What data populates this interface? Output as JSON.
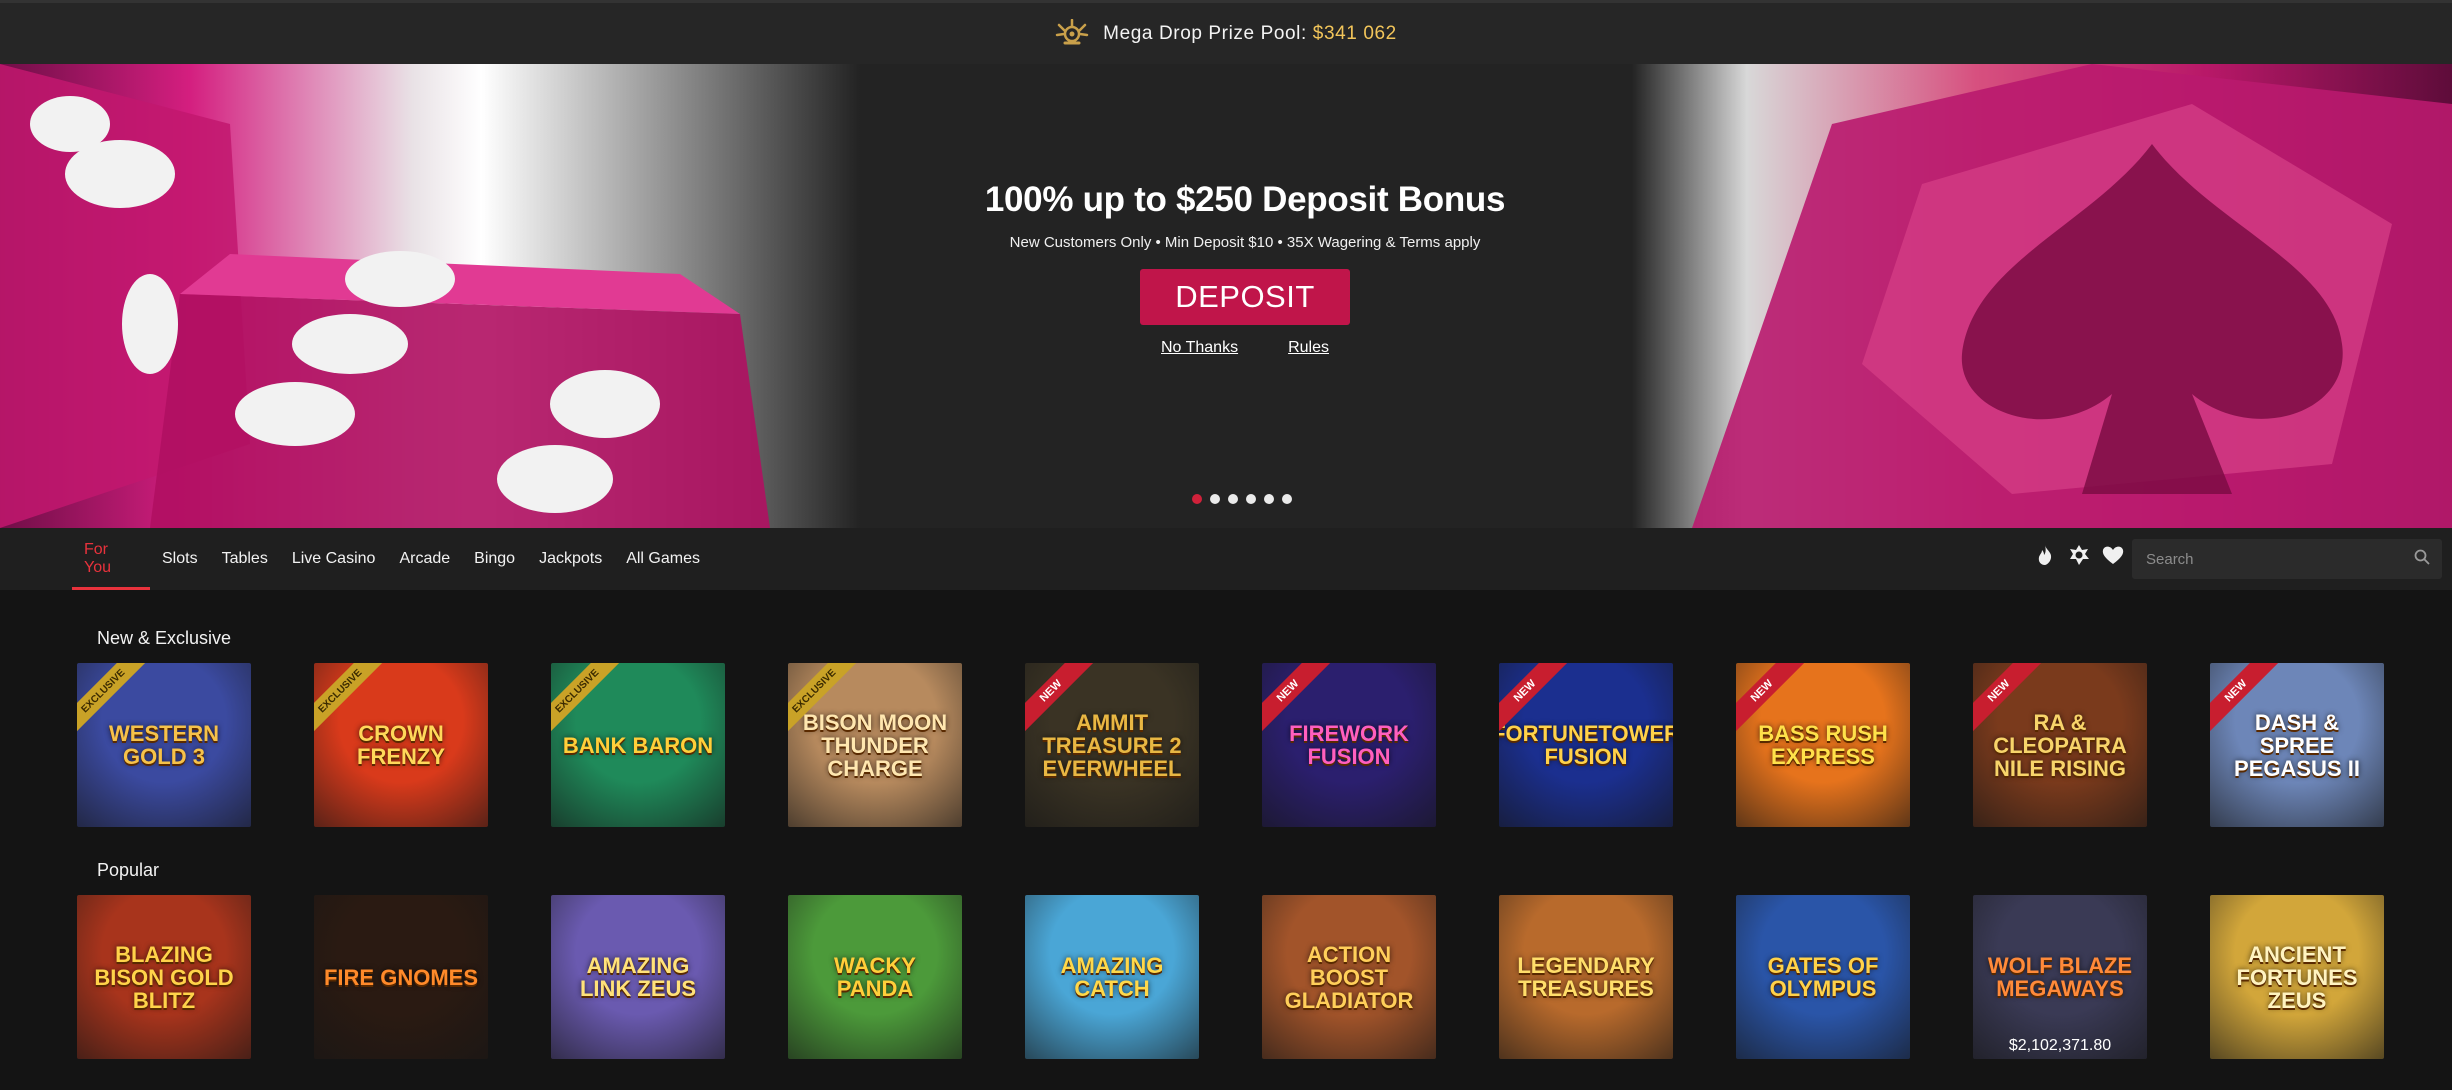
{
  "topbar": {
    "icon": "crown-icon",
    "label": "Mega Drop Prize Pool:",
    "value": "$341 062",
    "value_color": "#f2c55a"
  },
  "hero": {
    "title": "100% up to $250 Deposit Bonus",
    "terms": "New Customers Only • Min Deposit $10 • 35X Wagering & Terms apply",
    "deposit_label": "DEPOSIT",
    "no_thanks_label": "No Thanks",
    "rules_label": "Rules",
    "carousel_count": 6,
    "carousel_active": 1,
    "accent_color": "#c0154a"
  },
  "nav": {
    "tabs": [
      "For You",
      "Slots",
      "Tables",
      "Live Casino",
      "Arcade",
      "Bingo",
      "Jackpots",
      "All Games"
    ],
    "active_tab": "For You",
    "icons": [
      "fire-icon",
      "badge-icon",
      "heart-icon"
    ],
    "search_placeholder": "Search",
    "search_icon": "search-icon"
  },
  "sections": {
    "new": {
      "title": "New & Exclusive",
      "games": [
        {
          "name": "Western Gold 3",
          "badge": "EXCLUSIVE",
          "bg": "#3b4aa0",
          "color": "#f6c24a"
        },
        {
          "name": "Crown Frenzy",
          "badge": "EXCLUSIVE",
          "bg": "#d93a1b",
          "color": "#ffd85a"
        },
        {
          "name": "Bank Baron",
          "badge": "EXCLUSIVE",
          "bg": "#1f8a5a",
          "color": "#ffcf3a"
        },
        {
          "name": "Bison Moon Thunder Charge",
          "badge": "EXCLUSIVE",
          "bg": "#b78a5e",
          "color": "#ffe7b0"
        },
        {
          "name": "Ammit Treasure 2 Everwheel",
          "badge": "NEW",
          "bg": "#3a3324",
          "color": "#e8b743"
        },
        {
          "name": "Firework Fusion",
          "badge": "NEW",
          "bg": "#2b1f6e",
          "color": "#ff5fbf"
        },
        {
          "name": "Fortunetower Fusion",
          "badge": "NEW",
          "bg": "#1b2f8f",
          "color": "#ffd24a"
        },
        {
          "name": "Bass Rush Express",
          "badge": "NEW",
          "bg": "#e6731c",
          "color": "#ffe14a"
        },
        {
          "name": "Ra & Cleopatra Nile Rising",
          "badge": "NEW",
          "bg": "#7a3a1c",
          "color": "#f7d46a"
        },
        {
          "name": "Dash & Spree Pegasus II",
          "badge": "NEW",
          "bg": "#6d86b8",
          "color": "#ffffff"
        }
      ]
    },
    "popular": {
      "title": "Popular",
      "games": [
        {
          "name": "Blazing Bison Gold Blitz",
          "badge": "",
          "bg": "#a8341c",
          "color": "#ffd34a",
          "amount": ""
        },
        {
          "name": "Fire Gnomes",
          "badge": "",
          "bg": "#2a1a12",
          "color": "#ff8a2a",
          "amount": ""
        },
        {
          "name": "Amazing Link Zeus",
          "badge": "",
          "bg": "#6a5ab0",
          "color": "#ffe27a",
          "amount": ""
        },
        {
          "name": "Wacky Panda",
          "badge": "",
          "bg": "#4c9a3a",
          "color": "#ffcf3a",
          "amount": ""
        },
        {
          "name": "Amazing Catch",
          "badge": "",
          "bg": "#4aa6d6",
          "color": "#ffd84a",
          "amount": ""
        },
        {
          "name": "Action Boost Gladiator",
          "badge": "",
          "bg": "#a2542a",
          "color": "#ffcf5a",
          "amount": ""
        },
        {
          "name": "Legendary Treasures",
          "badge": "",
          "bg": "#b86a2c",
          "color": "#ffde6a",
          "amount": ""
        },
        {
          "name": "Gates of Olympus",
          "badge": "",
          "bg": "#2a55a8",
          "color": "#ffd24a",
          "amount": ""
        },
        {
          "name": "Wolf Blaze Megaways",
          "badge": "",
          "bg": "#3a3a55",
          "color": "#ff8a3a",
          "amount": "$2,102,371.80"
        },
        {
          "name": "Ancient Fortunes Zeus",
          "badge": "",
          "bg": "#d2a63a",
          "color": "#fff3c0",
          "amount": ""
        }
      ]
    }
  }
}
